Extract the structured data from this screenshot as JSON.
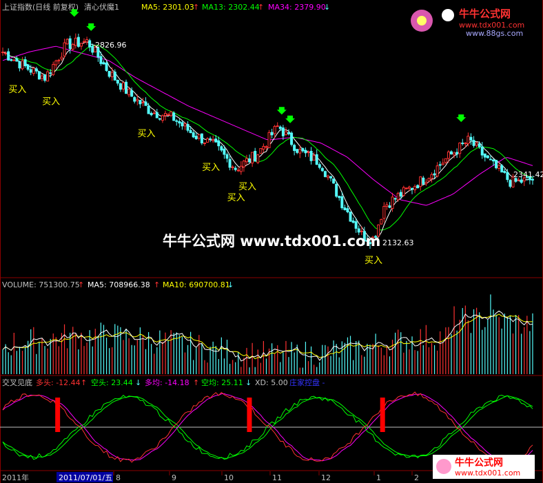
{
  "header_main": {
    "index_name": "上证指数(日线 前复权)",
    "formula": "清心伏魔1",
    "ma5": "MA5: 2301.03",
    "ma13": "MA13: 2302.44",
    "ma34": "MA34: 2379.90"
  },
  "header_volume": {
    "volume": "VOLUME: 751300.75",
    "ma5": "MA5: 708966.38",
    "ma10": "MA10: 690700.81"
  },
  "header_indicator": {
    "name": "交叉见底",
    "duotou": "多头: -12.44",
    "kongtou": "空头: 23.44",
    "duojun": "多均: -14.18",
    "kongjun": "空均: 25.11",
    "xd": "XD: 5.00",
    "extra": "庄家控盘 -"
  },
  "annotations": {
    "high_price": "2826.96",
    "low_price": "2132.63",
    "last_price": "2341.42",
    "buy_label": "买入"
  },
  "watermark_center": "牛牛公式网 www.tdx001.com",
  "logo_top": {
    "name": "牛牛公式网",
    "url1": "www.tdx001.com",
    "url2": "www.88gs.com"
  },
  "logo_bottom": {
    "name": "牛牛公式网",
    "url": "www.tdx001.com"
  },
  "date_axis": {
    "start_label": "2011年",
    "selected_date": "2011/07/01/五",
    "ticks": [
      "8",
      "9",
      "10",
      "11",
      "12",
      "1",
      "2"
    ]
  },
  "colors": {
    "up_candle": "#ff3232",
    "down_candle": "#54fcfc",
    "ma5": "#ffffff",
    "ma13": "#ffff00",
    "ma34": "#ff00ff",
    "duotou": "#ff3232",
    "kongtou": "#00ff00",
    "duojun": "#ff00ff",
    "kongjun": "#00ff00",
    "signal_bar": "#ff0000",
    "buy_text": "#ffff00",
    "green_arrow": "#00ff00"
  },
  "chart_data": {
    "type": "line",
    "ma34_price_path": [
      [
        0,
        2760
      ],
      [
        0.05,
        2790
      ],
      [
        0.1,
        2810
      ],
      [
        0.15,
        2785
      ],
      [
        0.2,
        2760
      ],
      [
        0.25,
        2700
      ],
      [
        0.3,
        2650
      ],
      [
        0.35,
        2600
      ],
      [
        0.4,
        2560
      ],
      [
        0.45,
        2520
      ],
      [
        0.5,
        2480
      ],
      [
        0.55,
        2490
      ],
      [
        0.6,
        2470
      ],
      [
        0.65,
        2420
      ],
      [
        0.7,
        2340
      ],
      [
        0.75,
        2270
      ],
      [
        0.8,
        2250
      ],
      [
        0.85,
        2290
      ],
      [
        0.9,
        2360
      ],
      [
        0.95,
        2420
      ],
      [
        1.0,
        2390
      ]
    ],
    "price_path": [
      [
        0,
        2790
      ],
      [
        0.04,
        2740
      ],
      [
        0.08,
        2700
      ],
      [
        0.12,
        2815
      ],
      [
        0.16,
        2826.96
      ],
      [
        0.2,
        2720
      ],
      [
        0.24,
        2640
      ],
      [
        0.28,
        2580
      ],
      [
        0.32,
        2560
      ],
      [
        0.36,
        2500
      ],
      [
        0.4,
        2460
      ],
      [
        0.44,
        2380
      ],
      [
        0.48,
        2430
      ],
      [
        0.52,
        2530
      ],
      [
        0.56,
        2440
      ],
      [
        0.6,
        2400
      ],
      [
        0.64,
        2260
      ],
      [
        0.68,
        2140
      ],
      [
        0.7,
        2132.63
      ],
      [
        0.72,
        2250
      ],
      [
        0.76,
        2300
      ],
      [
        0.8,
        2350
      ],
      [
        0.84,
        2420
      ],
      [
        0.88,
        2480
      ],
      [
        0.92,
        2400
      ],
      [
        0.96,
        2330
      ],
      [
        1.0,
        2341.42
      ]
    ],
    "buy_signal_positions": [
      0.025,
      0.09,
      0.27,
      0.39,
      0.44,
      0.46,
      0.7
    ],
    "signal_bar_positions": [
      0.105,
      0.465,
      0.715
    ]
  }
}
